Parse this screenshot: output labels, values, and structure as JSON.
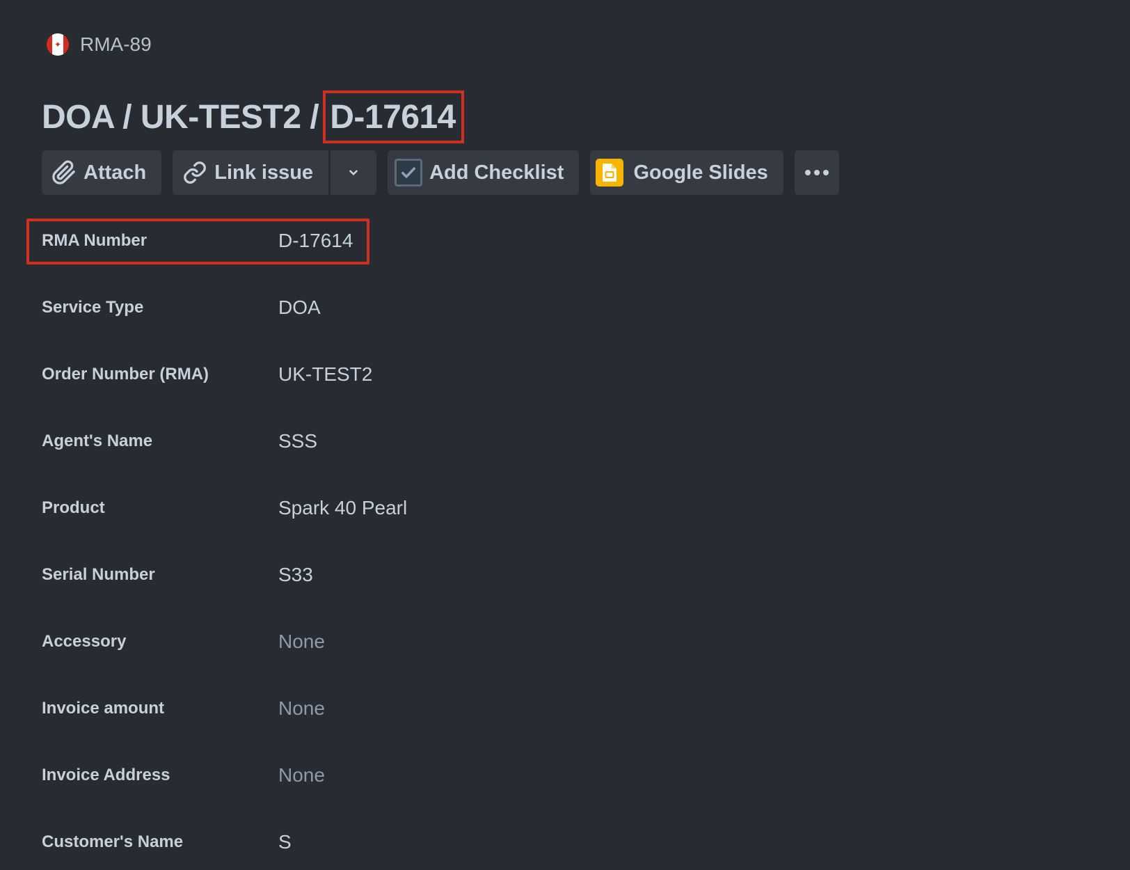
{
  "breadcrumb": {
    "issue_key": "RMA-89"
  },
  "title": {
    "prefix": "DOA / UK-TEST2 /",
    "highlighted": "D-17614"
  },
  "toolbar": {
    "attach_label": "Attach",
    "link_issue_label": "Link issue",
    "add_checklist_label": "Add Checklist",
    "google_slides_label": "Google Slides"
  },
  "fields": [
    {
      "label": "RMA Number",
      "value": "D-17614"
    },
    {
      "label": "Service Type",
      "value": "DOA"
    },
    {
      "label": "Order Number (RMA)",
      "value": "UK-TEST2"
    },
    {
      "label": "Agent's Name",
      "value": "SSS"
    },
    {
      "label": "Product",
      "value": "Spark 40 Pearl"
    },
    {
      "label": "Serial Number",
      "value": "S33"
    },
    {
      "label": "Accessory",
      "value": "None"
    },
    {
      "label": "Invoice amount",
      "value": "None"
    },
    {
      "label": "Invoice Address",
      "value": "None"
    },
    {
      "label": "Customer's Name",
      "value": "S"
    }
  ],
  "colors": {
    "background": "#282c32",
    "button": "#363b43",
    "highlight": "#d0301f",
    "text": "#c7d1db",
    "muted": "#8c9bab"
  },
  "icons": {
    "breadcrumb": "canada-flag-icon",
    "attach": "paperclip-icon",
    "link": "link-icon",
    "dropdown": "chevron-down-icon",
    "checklist": "checkbox-checked-icon",
    "slides": "google-slides-icon",
    "more": "more-horizontal-icon"
  }
}
